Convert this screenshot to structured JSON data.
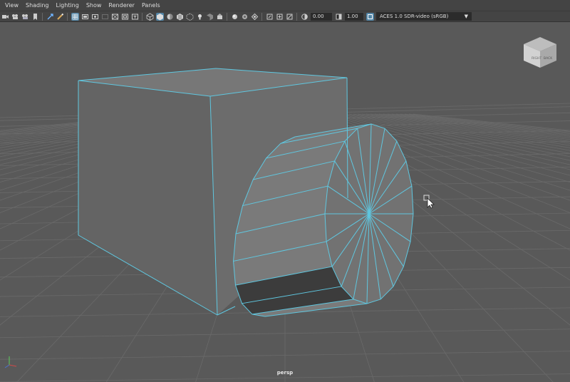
{
  "menu": [
    "View",
    "Shading",
    "Lighting",
    "Show",
    "Renderer",
    "Panels"
  ],
  "toolbar": {
    "exposure": "0.00",
    "gamma": "1.00",
    "color_space": "ACES 1.0 SDR-video (sRGB)"
  },
  "viewport": {
    "camera_label": "persp",
    "viewcube": {
      "face_right": "RIGHT",
      "face_back": "BACK"
    }
  },
  "colors": {
    "background": "#595959",
    "grid": "#6a6a6a",
    "wire": "#5fc7e0",
    "ui_bar": "#444444",
    "active_icon": "#5285a6"
  }
}
